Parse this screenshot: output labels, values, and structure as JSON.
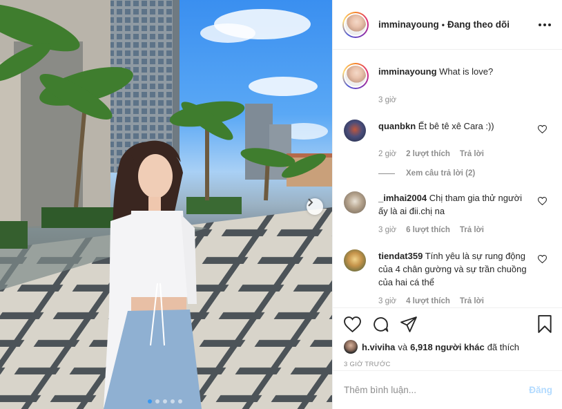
{
  "post": {
    "username": "imminayoung",
    "separator": "•",
    "follow_status": "Đang theo dõi"
  },
  "caption": {
    "username": "imminayoung",
    "text": "What is love?",
    "time": "3 giờ"
  },
  "comments": [
    {
      "username": "quanbkn",
      "text": "Ết bê tê xê Cara :))",
      "time": "2 giờ",
      "likes": "2 lượt thích",
      "reply": "Trả lời",
      "view_replies": "Xem câu trả lời (2)"
    },
    {
      "username": "_imhai2004",
      "text": "Chị tham gia thử người ấy là ai đii.chị na",
      "time": "3 giờ",
      "likes": "6 lượt thích",
      "reply": "Trả lời"
    },
    {
      "username": "tiendat359",
      "text": "Tính yêu là sự rung động của 4 chân gường và sự trần chuồng của hai cá thể",
      "time": "3 giờ",
      "likes": "4 lượt thích",
      "reply": "Trả lời"
    }
  ],
  "likes": {
    "first_user": "h.viviha",
    "connector": "và",
    "others": "6,918 người khác",
    "suffix": "đã thích"
  },
  "timestamp": "3 GIỜ TRƯỚC",
  "add_comment": {
    "placeholder": "Thêm bình luận...",
    "post_label": "Đăng"
  },
  "carousel": {
    "slide_count": 5,
    "active_index": 0
  },
  "colors": {
    "accent": "#3897f0",
    "post_disabled": "#b3dbff",
    "muted": "#8e8e8e",
    "text": "#262626"
  }
}
